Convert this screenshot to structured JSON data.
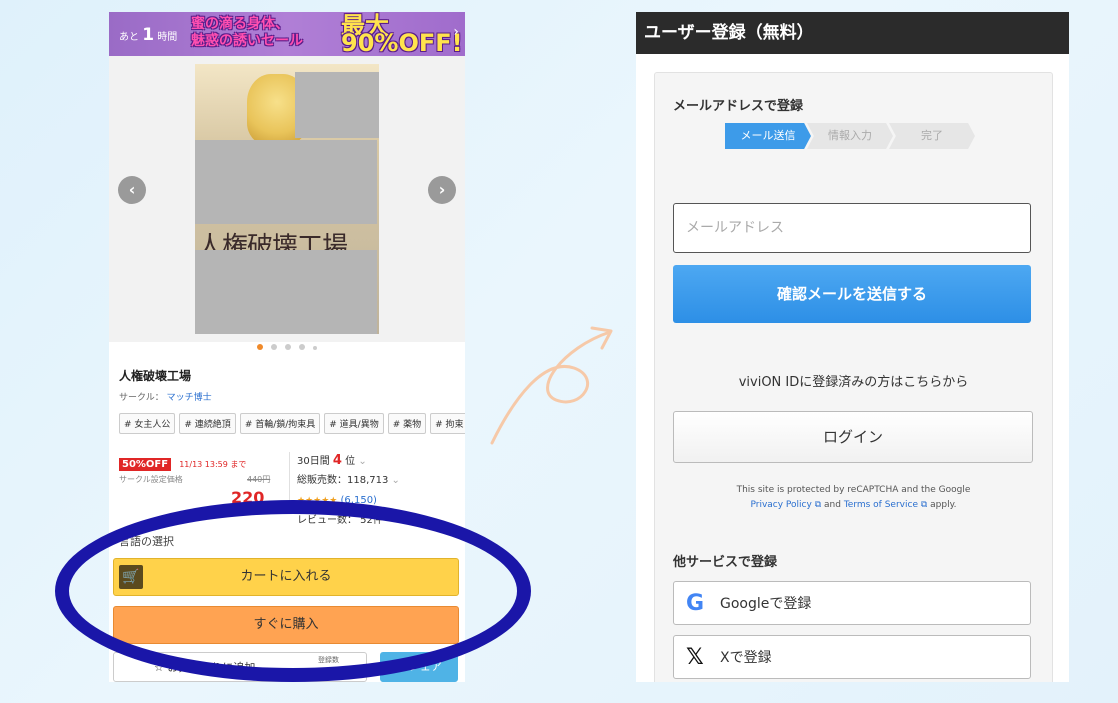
{
  "left": {
    "banner": {
      "timer_prefix": "あと",
      "timer_num": "1",
      "timer_unit": "時間",
      "promo_line1": "蜜の滴る身体、",
      "promo_line2": "魅惑の誘いセール",
      "promo_big": "最大90%OFF!!",
      "arrow": "›"
    },
    "cover_title": "人権破壊工場",
    "nav_prev": "‹",
    "nav_next": "›",
    "product_title": "人権破壊工場",
    "circle_label": "サークル：",
    "circle_name": "マッチ博士",
    "tags": [
      "# 女主人公",
      "# 連続絶頂",
      "# 首輪/鎖/拘束具",
      "# 道具/異物",
      "# 薬物",
      "# 拘束"
    ],
    "discount_badge": "50%OFF",
    "discount_until": "11/13 13:59 まで",
    "circle_price_label": "サークル設定価格",
    "original_price": "440円",
    "sale_price": "220",
    "rank_period": "30日間",
    "rank_num": "4",
    "rank_unit": "位",
    "total_sales": "総販売数：118,713",
    "rating_stars": "★★★★★",
    "rating_count": "(6,150)",
    "review_count": "レビュー数： 52件",
    "lang_label": "言語の選択",
    "cart_button": "カートに入れる",
    "cart_icon": "🛒",
    "buy_button": "すぐに購入",
    "fav_button": "☆ お気に入りに追加",
    "fav_count_label": "登録数",
    "share_button": "↑ シェア"
  },
  "right": {
    "header_title": "ユーザー登録（無料）",
    "email_section_title": "メールアドレスで登録",
    "steps": [
      "メール送信",
      "情報入力",
      "完了"
    ],
    "email_placeholder": "メールアドレス",
    "send_button": "確認メールを送信する",
    "vivion_text": "viviON IDに登録済みの方はこちらから",
    "login_button": "ログイン",
    "recaptcha_line1": "This site is protected by reCAPTCHA and the Google",
    "privacy_link": "Privacy Policy",
    "and_text": "and",
    "terms_link": "Terms of Service",
    "apply_text": "apply.",
    "other_services_title": "他サービスで登録",
    "google_button": "Googleで登録",
    "google_icon": "G",
    "x_button": "Xで登録",
    "x_icon": "𝕏"
  },
  "colors": {
    "ellipse": "#1a16a8",
    "primary_blue": "#2d8fe6",
    "cart_yellow": "#ffd24a",
    "buy_orange": "#ffa352",
    "sale_red": "#e02626",
    "arrow_peach": "#f6c9a8"
  }
}
